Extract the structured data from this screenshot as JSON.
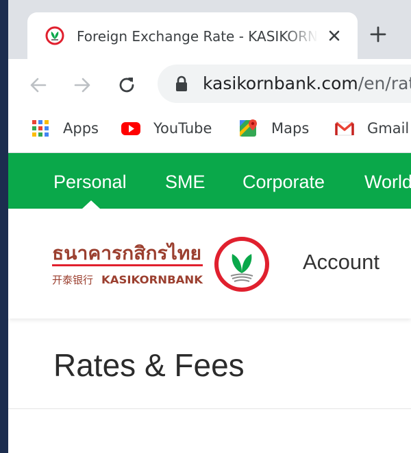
{
  "browser": {
    "tab": {
      "title": "Foreign Exchange Rate - KASIKORNBANK",
      "favicon": "kbank-leaf-icon"
    },
    "url": {
      "domain": "kasikornbank.com",
      "path": "/en/rates"
    },
    "bookmarks": [
      {
        "label": "Apps",
        "icon": "apps-grid-icon"
      },
      {
        "label": "YouTube",
        "icon": "youtube-icon"
      },
      {
        "label": "Maps",
        "icon": "maps-icon"
      },
      {
        "label": "Gmail",
        "icon": "gmail-icon"
      }
    ]
  },
  "site": {
    "nav": [
      "Personal",
      "SME",
      "Corporate",
      "World"
    ],
    "active_nav": "Personal",
    "logo": {
      "thai": "ธนาคารกสิกรไทย",
      "chinese": "开泰银行",
      "english": "KASIKORNBANK"
    },
    "account_label": "Account",
    "page_title": "Rates & Fees"
  },
  "colors": {
    "brand_green": "#0aa84a",
    "brand_red": "#e0202e",
    "logo_brown": "#9b3f2f"
  }
}
